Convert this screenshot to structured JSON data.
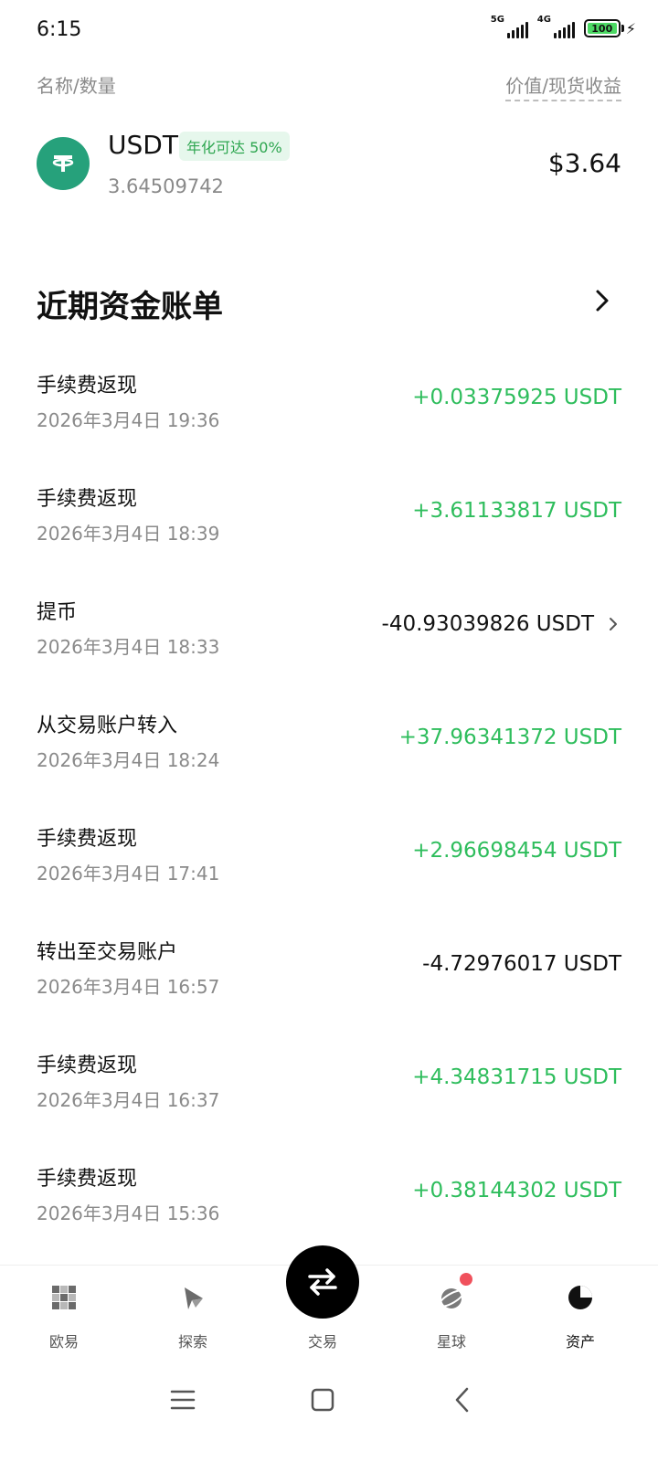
{
  "status_bar": {
    "time": "6:15",
    "net1": "5G",
    "net2": "4G",
    "battery": "100"
  },
  "header": {
    "left": "名称/数量",
    "right": "价值/现货收益"
  },
  "asset": {
    "icon": "tether-icon",
    "name": "USDT",
    "badge": "年化可达 50%",
    "quantity": "3.64509742",
    "value": "$3.64"
  },
  "section": {
    "title": "近期资金账单"
  },
  "transactions": [
    {
      "title": "手续费返现",
      "time": "2026年3月4日 19:36",
      "amount": "+0.03375925 USDT",
      "positive": true
    },
    {
      "title": "手续费返现",
      "time": "2026年3月4日 18:39",
      "amount": "+3.61133817 USDT",
      "positive": true
    },
    {
      "title": "提币",
      "time": "2026年3月4日 18:33",
      "amount": "-40.93039826 USDT",
      "positive": false
    },
    {
      "title": "从交易账户转入",
      "time": "2026年3月4日 18:24",
      "amount": "+37.96341372 USDT",
      "positive": true
    },
    {
      "title": "手续费返现",
      "time": "2026年3月4日 17:41",
      "amount": "+2.96698454 USDT",
      "positive": true
    },
    {
      "title": "转出至交易账户",
      "time": "2026年3月4日 16:57",
      "amount": "-4.72976017 USDT",
      "positive": false
    },
    {
      "title": "手续费返现",
      "time": "2026年3月4日 16:37",
      "amount": "+4.34831715 USDT",
      "positive": true
    },
    {
      "title": "手续费返现",
      "time": "2026年3月4日 15:36",
      "amount": "+0.38144302 USDT",
      "positive": true
    }
  ],
  "bottom_nav": {
    "items": [
      {
        "label": "欧易",
        "icon": "okx-logo-icon"
      },
      {
        "label": "探索",
        "icon": "compass-icon"
      },
      {
        "label": "交易",
        "icon": "swap-arrows-icon"
      },
      {
        "label": "星球",
        "icon": "planet-icon"
      },
      {
        "label": "资产",
        "icon": "pie-chart-icon"
      }
    ],
    "active_index": 4
  },
  "colors": {
    "positive": "#2ebd5c",
    "negative": "#111111",
    "tether": "#26a17b",
    "badge_bg": "#e6f7ec",
    "notify_dot": "#f0515c"
  }
}
